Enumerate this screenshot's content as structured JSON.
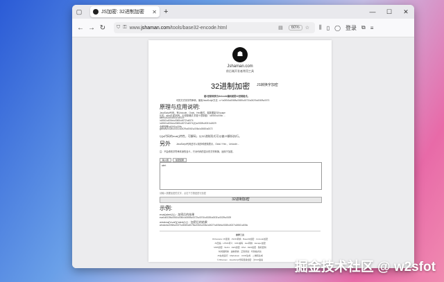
{
  "browser": {
    "tab_title": "JS加密: 32进制加密",
    "new_tab": "+",
    "url_prefix": "www.",
    "url_domain": "jshaman.com",
    "url_path": "/tools/base32-encode.html",
    "zoom": "60%",
    "login": "登录"
  },
  "page": {
    "site_name": "Jshaman.com",
    "site_tagline": "前后端开发者常用工具",
    "title": "32进制加密",
    "title_side": "JS转换字加密",
    "notice": "被2进制转换为Unicode编码就是32进制格式。",
    "intro": "可的方式将字符串转，使用JavaScript方法 - u+\\u0054\\u0068\\u0069\\u0073\\u0020\\u0069\\u0073",
    "section_principle": "原理与应用说明:",
    "principle_lines": [
      "JavaScript代码，有Unicode、Octal、Hex格式，各数据量与Escape",
      "比如，alert(1)的代码，32进制格式 的是十进制值：\\u0061\\u006c ...",
      "alert\\u0028\\u0031\\u0029",
      "\\u0061\\u006c\\u0065\\u0072\\u0074",
      "\\u0061\\u006c\\u0065\\u0072\\u0074(1)\\u0028\\u0031\\u0029",
      "全都相等\\u0061\\u006c",
      "global\\u0028\\u0031\\u0029\\u0061\\u006c\\u0065\\u0072"
    ],
    "eval_line": "以js代码的eval()特性，可解码，以32进制形式可以被JS解析执行。",
    "section_other": "另外",
    "other_line": "JavaScript代码还可以用多种进制表示，Octal / Hex 、Unicode...",
    "other_line2": "注：不会修改字符串本身的含义，只对代码的显示形式作转换，适用于加密。",
    "input_tab_1": "输入框",
    "input_tab_2": "加密结果",
    "textarea_placeholder": "alert",
    "input_hint": "请输入需要加密的文字，点击下方按钮进行加密",
    "encrypt_button": "32进制加密",
    "section_example": "示例:",
    "example1_title": "eval(alert(1)) · 加密后的结果",
    "example1_code": "eval\\u0028\\u0061\\u006c\\u0065\\u0072\\u0074\\u0028\\u0031\\u0029\\u0029",
    "example2_title": "window['eval']('alert(1)') · 加密后的结果",
    "example2_code": "window\\u005b\\u0027\\u0065\\u0076\\u0061\\u006c\\u0027\\u005d\\u0028\\u0027\\u0061\\u006c",
    "footer_heading": "推荐工具",
    "footer_rows": [
      "Obfuscator JS混淆 · JSON转换 · Base64加密 · Unicode加密",
      "JS压缩 · HTML转义 · URL编码 · Hex转换 · Escape加密",
      "MD5加密 · SHA1 · AES加密 · RSA · DES加密 · 随机密码",
      "时间戳转换 · 进制转换 · 正则测试 · 代码格式化",
      "JS在线运行 · Markdown · UUID生成 · 二维码生成"
    ],
    "copyright": "©JShaman · JavaScript代码混淆加密 · 沪ICP备案"
  },
  "watermark": "掘金技术社区 @ w2sfot"
}
